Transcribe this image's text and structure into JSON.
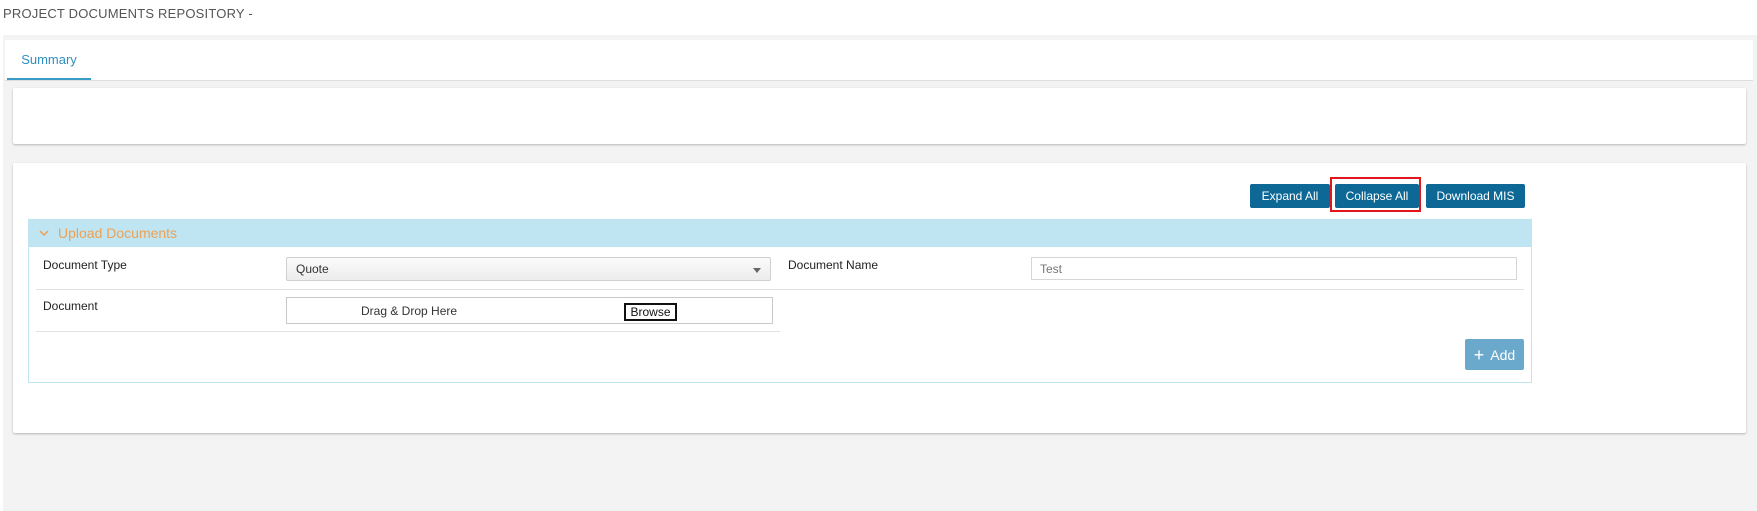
{
  "page": {
    "title": "PROJECT DOCUMENTS REPOSITORY -"
  },
  "tabs": [
    {
      "label": "Summary",
      "active": true
    }
  ],
  "toolbar": {
    "expand_all": "Expand All",
    "collapse_all": "Collapse All",
    "download_mis": "Download MIS",
    "highlighted": "Collapse All",
    "highlight_color": "#e0181e"
  },
  "section": {
    "title": "Upload Documents",
    "icon": "chevron-down-icon",
    "header_color": "#bfe5f3",
    "title_color": "#f0a050"
  },
  "form": {
    "document_type": {
      "label": "Document Type",
      "value": "Quote"
    },
    "document_name": {
      "label": "Document Name",
      "placeholder": "Test"
    },
    "document": {
      "label": "Document",
      "drop_text": "Drag & Drop Here",
      "browse_label": "Browse"
    },
    "add_button": {
      "icon": "plus-icon",
      "label": "Add"
    }
  },
  "colors": {
    "primary_button": "#0d6896",
    "add_button": "#6aa8cc",
    "tab_accent": "#3a9bc4"
  }
}
